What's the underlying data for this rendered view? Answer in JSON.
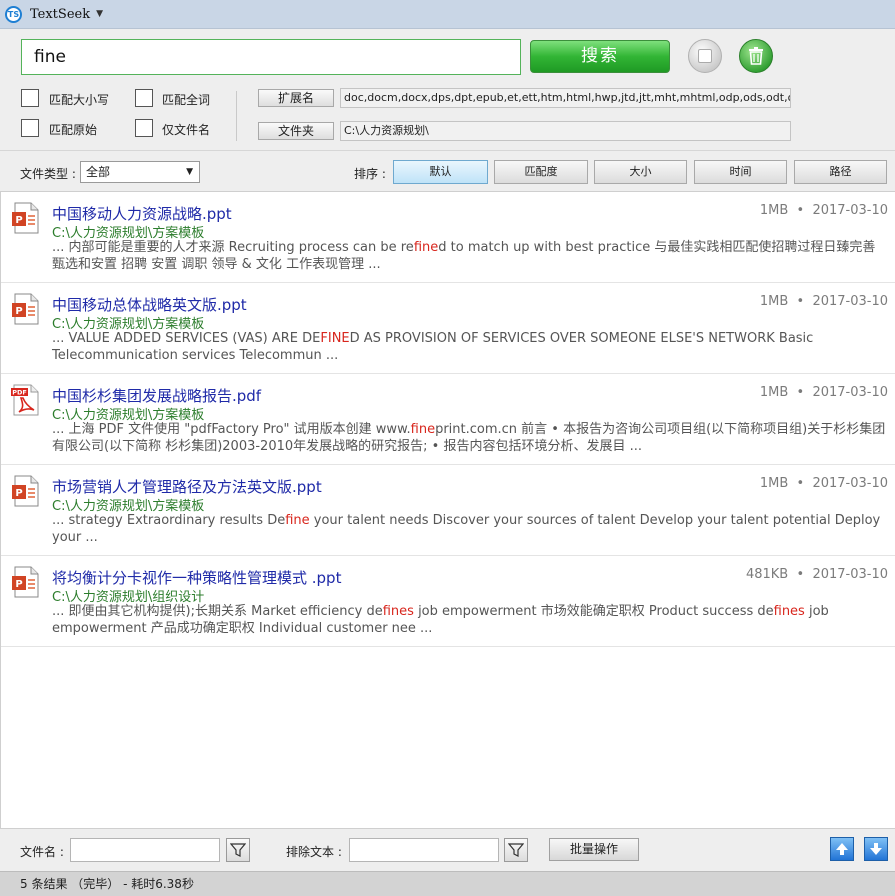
{
  "titlebar": {
    "logo_text": "TS",
    "app_name": "TextSeek"
  },
  "search": {
    "query": "fine",
    "search_button": "搜索",
    "options": {
      "match_case": "匹配大小写",
      "match_whole_word": "匹配全词",
      "match_original": "匹配原始",
      "filename_only": "仅文件名"
    },
    "ext_label": "扩展名",
    "ext_value": "doc,docm,docx,dps,dpt,epub,et,ett,htm,html,hwp,jtd,jtt,mht,mhtml,odp,ods,odt,ofd,",
    "folder_label": "文件夹",
    "folder_value": "C:\\人力资源规划\\"
  },
  "filter": {
    "filetype_label": "文件类型 :",
    "filetype_value": "全部",
    "sort_label": "排序 :",
    "sort_options": [
      "默认",
      "匹配度",
      "大小",
      "时间",
      "路径"
    ],
    "sort_selected": "默认"
  },
  "results": [
    {
      "type": "ppt",
      "title": "中国移动人力资源战略.ppt",
      "size": "1MB",
      "date": "2017-03-10",
      "path": "C:\\人力资源规划\\方案模板",
      "snippet_pre": "... 内部可能是重要的人才来源 Recruiting process can be re",
      "snippet_hl": "fine",
      "snippet_post": "d to match up with best practice 与最佳实践相匹配使招聘过程日臻完善 甄选和安置 招聘 安置 调职 领导 & 文化 工作表现管理 ..."
    },
    {
      "type": "ppt",
      "title": "中国移动总体战略英文版.ppt",
      "size": "1MB",
      "date": "2017-03-10",
      "path": "C:\\人力资源规划\\方案模板",
      "snippet_pre": "... VALUE ADDED SERVICES (VAS) ARE DE",
      "snippet_hl": "FINE",
      "snippet_post": "D AS PROVISION OF SERVICES OVER SOMEONE ELSE'S NETWORK Basic Telecommunication services Telecommun ..."
    },
    {
      "type": "pdf",
      "title": "中国杉杉集团发展战略报告.pdf",
      "size": "1MB",
      "date": "2017-03-10",
      "path": "C:\\人力资源规划\\方案模板",
      "snippet_pre": "... 上海 PDF 文件使用 \"pdfFactory Pro\" 试用版本创建 www.",
      "snippet_hl": "fine",
      "snippet_post": "print.com.cn 前言 • 本报告为咨询公司项目组(以下简称项目组)关于杉杉集团有限公司(以下简称 杉杉集团)2003-2010年发展战略的研究报告; • 报告内容包括环境分析、发展目 ..."
    },
    {
      "type": "ppt",
      "title": "市场营销人才管理路径及方法英文版.ppt",
      "size": "1MB",
      "date": "2017-03-10",
      "path": "C:\\人力资源规划\\方案模板",
      "snippet_pre": "... strategy Extraordinary results De",
      "snippet_hl": "fine",
      "snippet_post": " your talent needs Discover your sources of talent Develop your talent potential Deploy your ..."
    },
    {
      "type": "ppt",
      "title": "将均衡计分卡视作一种策略性管理模式 .ppt",
      "size": "481KB",
      "date": "2017-03-10",
      "path": "C:\\人力资源规划\\组织设计",
      "snippet_pre": "... 即便由其它机构提供);长期关系 Market efficiency de",
      "snippet_hl": "fines",
      "snippet_post": " job empowerment 市场效能确定职权 Product success de",
      "snippet_hl2": "fines",
      "snippet_post2": " job empowerment 产品成功确定职权 Individual customer nee ..."
    }
  ],
  "bottom": {
    "filename_label": "文件名 :",
    "exclude_label": "排除文本 :",
    "batch_button": "批量操作"
  },
  "status": {
    "text": "5 条结果 （完毕） - 耗时6.38秒"
  }
}
